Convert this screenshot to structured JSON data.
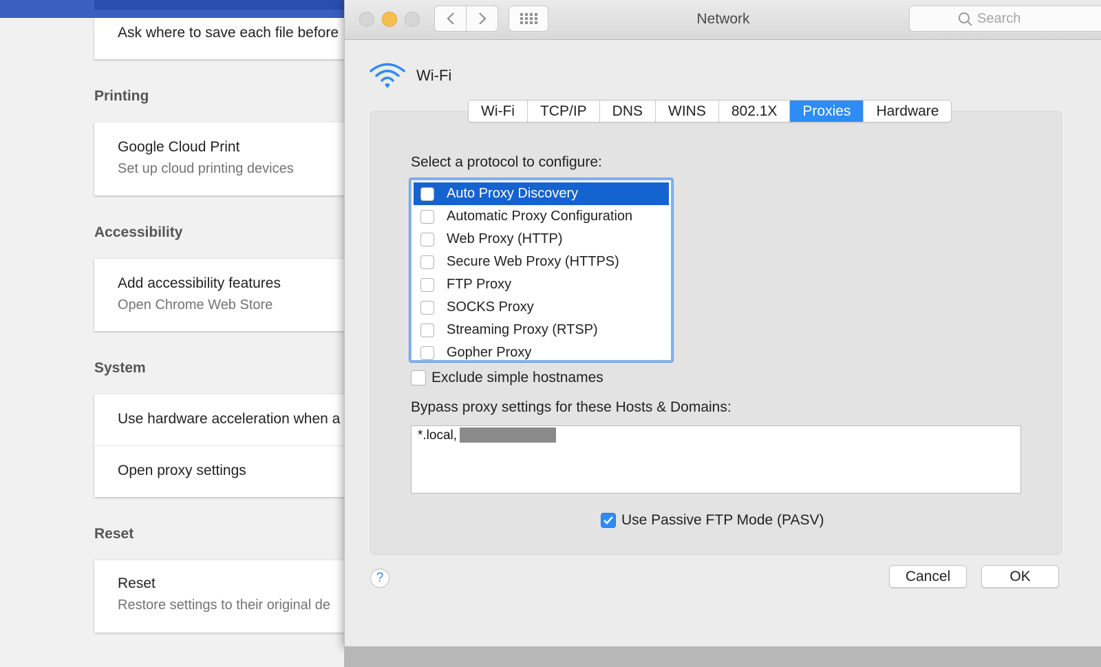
{
  "chrome": {
    "top_partial": "Ask where to save each file before",
    "sections": [
      {
        "title": "Printing",
        "rows": [
          {
            "title": "Google Cloud Print",
            "sub": "Set up cloud printing devices"
          }
        ]
      },
      {
        "title": "Accessibility",
        "rows": [
          {
            "title": "Add accessibility features",
            "sub": "Open Chrome Web Store"
          }
        ]
      },
      {
        "title": "System",
        "rows": [
          {
            "title": "Use hardware acceleration when a"
          },
          {
            "title": "Open proxy settings"
          }
        ]
      },
      {
        "title": "Reset",
        "rows": [
          {
            "title": "Reset",
            "sub": "Restore settings to their original de"
          }
        ]
      }
    ]
  },
  "window": {
    "title": "Network",
    "search_placeholder": "Search",
    "interface_name": "Wi-Fi",
    "tabs": [
      {
        "label": "Wi-Fi"
      },
      {
        "label": "TCP/IP"
      },
      {
        "label": "DNS"
      },
      {
        "label": "WINS"
      },
      {
        "label": "802.1X"
      },
      {
        "label": "Proxies",
        "active": true
      },
      {
        "label": "Hardware"
      }
    ],
    "protocol_prompt": "Select a protocol to configure:",
    "protocols": [
      {
        "label": "Auto Proxy Discovery",
        "checked": false,
        "selected": true
      },
      {
        "label": "Automatic Proxy Configuration",
        "checked": false
      },
      {
        "label": "Web Proxy (HTTP)",
        "checked": false
      },
      {
        "label": "Secure Web Proxy (HTTPS)",
        "checked": false
      },
      {
        "label": "FTP Proxy",
        "checked": false
      },
      {
        "label": "SOCKS Proxy",
        "checked": false
      },
      {
        "label": "Streaming Proxy (RTSP)",
        "checked": false
      },
      {
        "label": "Gopher Proxy",
        "checked": false
      }
    ],
    "exclude_label": "Exclude simple hostnames",
    "exclude_checked": false,
    "bypass_label": "Bypass proxy settings for these Hosts & Domains:",
    "bypass_value": "*.local,",
    "pasv_label": "Use Passive FTP Mode (PASV)",
    "pasv_checked": true,
    "help_label": "?",
    "cancel_label": "Cancel",
    "ok_label": "OK"
  },
  "colors": {
    "accent": "#2d8cf5",
    "selection": "#1562d1",
    "chrome_blue": "#3b5fc0"
  }
}
